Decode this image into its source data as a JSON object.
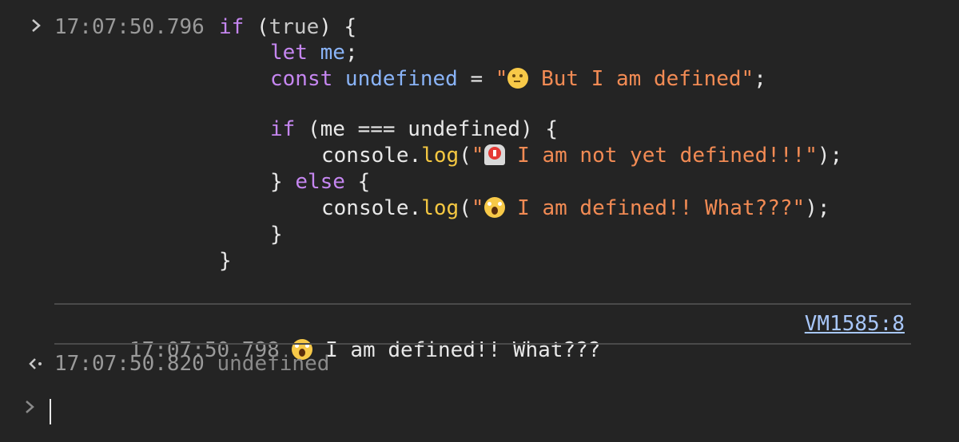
{
  "input_entry": {
    "timestamp": "17:07:50.796",
    "code_lines": [
      [
        {
          "t": "kw",
          "v": "if "
        },
        {
          "t": "paren",
          "v": "("
        },
        {
          "t": "lit",
          "v": "true"
        },
        {
          "t": "paren",
          "v": ") {"
        }
      ],
      [
        {
          "t": "kw",
          "v": "let "
        },
        {
          "t": "var",
          "v": "me"
        },
        {
          "t": "plain",
          "v": ";"
        }
      ],
      [
        {
          "t": "kw",
          "v": "const "
        },
        {
          "t": "var",
          "v": "undefined"
        },
        {
          "t": "plain",
          "v": " = "
        },
        {
          "t": "str",
          "v": "\""
        },
        {
          "t": "emoji",
          "v": "thinking"
        },
        {
          "t": "str",
          "v": " But I am defined\""
        },
        {
          "t": "plain",
          "v": ";"
        }
      ],
      [],
      [
        {
          "t": "kw",
          "v": "if "
        },
        {
          "t": "plain",
          "v": "(me === undefined) {"
        }
      ],
      [
        {
          "t": "plain",
          "v": "console."
        },
        {
          "t": "fn",
          "v": "log"
        },
        {
          "t": "plain",
          "v": "("
        },
        {
          "t": "str",
          "v": "\""
        },
        {
          "t": "emoji",
          "v": "siren"
        },
        {
          "t": "str",
          "v": " I am not yet defined!!!\""
        },
        {
          "t": "plain",
          "v": ");"
        }
      ],
      [
        {
          "t": "plain",
          "v": "} "
        },
        {
          "t": "kw",
          "v": "else "
        },
        {
          "t": "plain",
          "v": "{"
        }
      ],
      [
        {
          "t": "plain",
          "v": "console."
        },
        {
          "t": "fn",
          "v": "log"
        },
        {
          "t": "plain",
          "v": "("
        },
        {
          "t": "str",
          "v": "\""
        },
        {
          "t": "emoji",
          "v": "scream"
        },
        {
          "t": "str",
          "v": " I am defined!! What???\""
        },
        {
          "t": "plain",
          "v": ");"
        }
      ],
      [
        {
          "t": "plain",
          "v": "}"
        }
      ],
      [
        {
          "t": "plain",
          "v": "}"
        }
      ]
    ]
  },
  "log_entry": {
    "timestamp": "17:07:50.798",
    "emoji": "scream",
    "message": " I am defined!! What???",
    "source": "VM1585:8"
  },
  "return_entry": {
    "timestamp": "17:07:50.820",
    "value": "undefined"
  },
  "icons": {
    "input_chevron": "chevron-right-icon",
    "return_arrow": "return-arrow-icon",
    "prompt_chevron": "chevron-right-icon"
  },
  "colors": {
    "background": "#242424",
    "keyword": "#c586f0",
    "variable": "#8ab4f8",
    "string": "#f28b54",
    "function": "#f5c842",
    "timestamp": "#9a9a9a",
    "link": "#a8c7fa"
  }
}
